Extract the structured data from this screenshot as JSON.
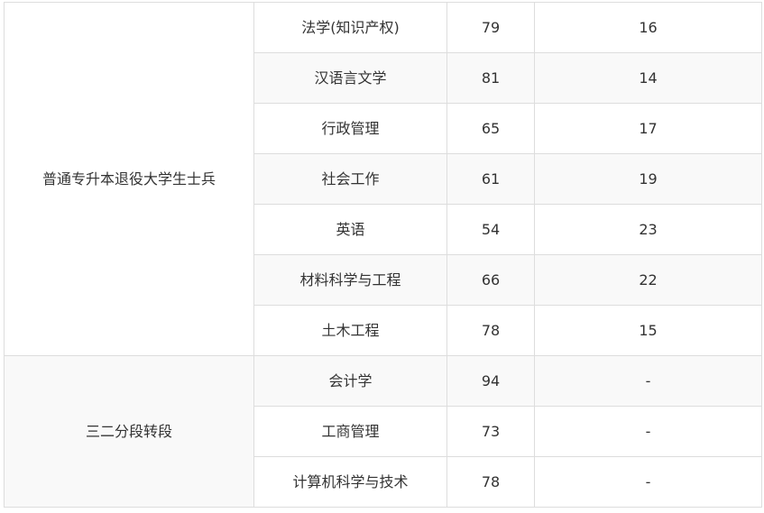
{
  "table": {
    "groups": [
      {
        "name": "普通专升本退役大学生士兵",
        "rows": [
          {
            "major": "法学(知识产权)",
            "score": "79",
            "count": "16"
          },
          {
            "major": "汉语言文学",
            "score": "81",
            "count": "14"
          },
          {
            "major": "行政管理",
            "score": "65",
            "count": "17"
          },
          {
            "major": "社会工作",
            "score": "61",
            "count": "19"
          },
          {
            "major": "英语",
            "score": "54",
            "count": "23"
          },
          {
            "major": "材料科学与工程",
            "score": "66",
            "count": "22"
          },
          {
            "major": "土木工程",
            "score": "78",
            "count": "15"
          }
        ]
      },
      {
        "name": "三二分段转段",
        "rows": [
          {
            "major": "会计学",
            "score": "94",
            "count": "-"
          },
          {
            "major": "工商管理",
            "score": "73",
            "count": "-"
          },
          {
            "major": "计算机科学与技术",
            "score": "78",
            "count": "-"
          }
        ]
      }
    ]
  }
}
